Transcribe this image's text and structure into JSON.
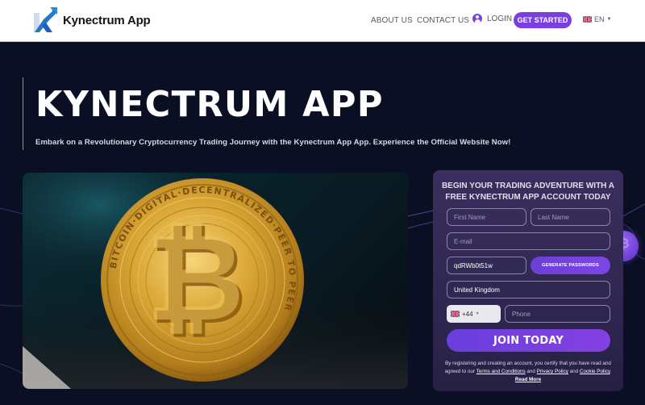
{
  "header": {
    "brand": "Kynectrum App",
    "nav": {
      "about": "ABOUT US",
      "contact": "CONTACT US",
      "login": "LOGIN",
      "get_started": "GET STARTED",
      "language": "EN"
    }
  },
  "hero": {
    "title": "KYNECTRUM APP",
    "subtitle": "Embark on a Revolutionary Cryptocurrency Trading Journey with the Kynectrum App App. Experience the Official Website Now!"
  },
  "image": {
    "coin_ring_text": "BITCOIN·DIGITAL·DECENTRALIZED·PEER TO PEER",
    "coin_symbol": "₿"
  },
  "form": {
    "title_line1": "BEGIN YOUR TRADING ADVENTURE WITH A",
    "title_line2": "FREE KYNECTRUM APP ACCOUNT TODAY",
    "first_name_placeholder": "First Name",
    "last_name_placeholder": "Last Name",
    "email_placeholder": "E-mail",
    "password_value": "qdRWb0t51w",
    "generate_label": "GENERATE PASSWORDS",
    "country_value": "United Kingdom",
    "phone_code": "+44",
    "phone_placeholder": "Phone",
    "join_label": "JOIN TODAY",
    "legal_prefix": "By registering and creating an account, you certify that you have read and agreed to our",
    "terms_label": "Terms and Conditions",
    "and1": "and",
    "privacy_label": "Privacy Policy",
    "and2": "and",
    "cookie_label": "Cookie Policy",
    "read_more_label": "Read More"
  },
  "colors": {
    "accent": "#7b3fe0",
    "background": "#0a0f24",
    "card": "#342a58"
  }
}
